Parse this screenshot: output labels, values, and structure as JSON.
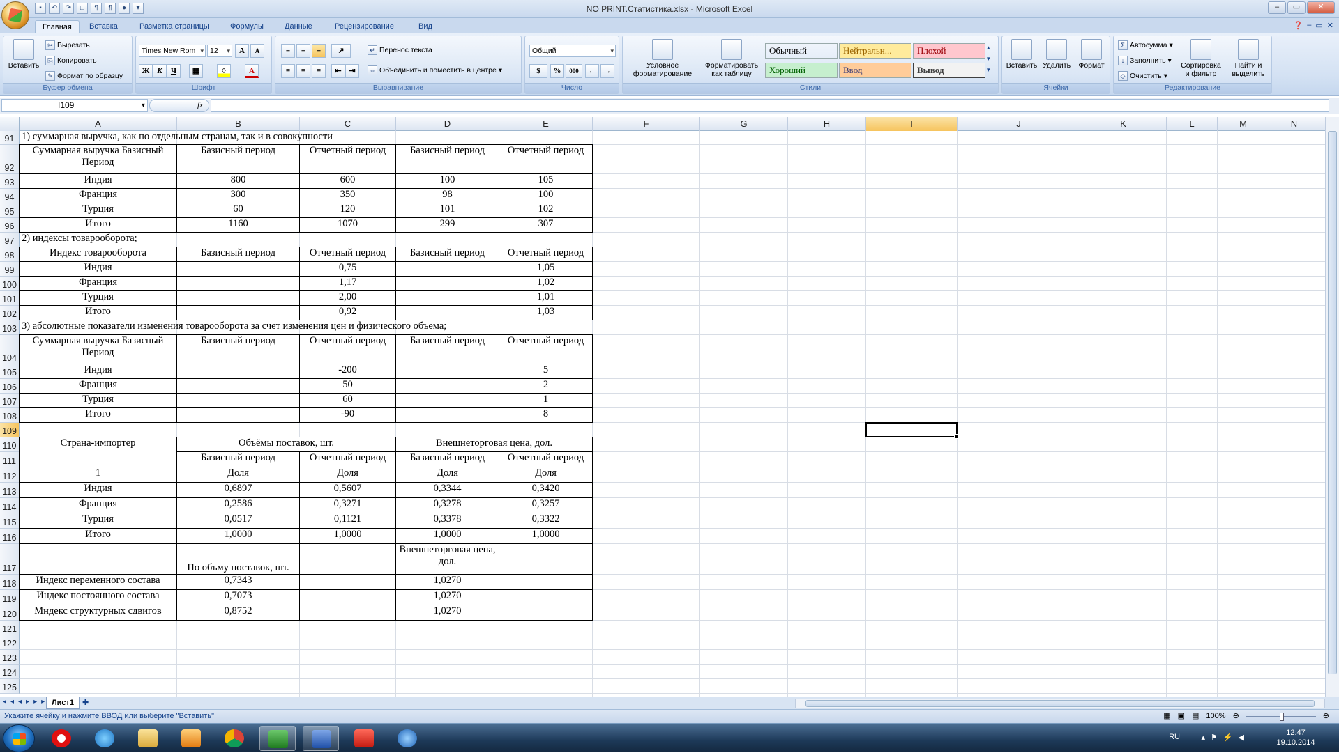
{
  "window": {
    "title": "NO PRINT.Статистика.xlsx - Microsoft Excel",
    "min": "–",
    "max": "▭",
    "close": "✕"
  },
  "tabs": [
    "Главная",
    "Вставка",
    "Разметка страницы",
    "Формулы",
    "Данные",
    "Рецензирование",
    "Вид"
  ],
  "ribbon": {
    "clipboard": {
      "label": "Буфер обмена",
      "paste": "Вставить",
      "cut": "Вырезать",
      "copy": "Копировать",
      "format_painter": "Формат по образцу"
    },
    "font": {
      "label": "Шрифт",
      "name": "Times New Rom",
      "size": "12",
      "bold": "Ж",
      "italic": "К",
      "underline": "Ч",
      "font_color": "A"
    },
    "alignment": {
      "label": "Выравнивание",
      "wrap": "Перенос текста",
      "merge": "Объединить и поместить в центре"
    },
    "number": {
      "label": "Число",
      "format": "Общий",
      "percent": "%",
      "thousands": "000"
    },
    "styles": {
      "label": "Стили",
      "cond_format": "Условное форматирование",
      "format_table": "Форматировать как таблицу",
      "boxes": [
        {
          "text": "Обычный",
          "bg": "#ffffff",
          "color": "#000000"
        },
        {
          "text": "Нейтральн...",
          "bg": "#ffeb9c",
          "color": "#9c6500"
        },
        {
          "text": "Плохой",
          "bg": "#ffc7ce",
          "color": "#9c0006"
        },
        {
          "text": "Хороший",
          "bg": "#c6efce",
          "color": "#006100"
        },
        {
          "text": "Ввод",
          "bg": "#ffcc99",
          "color": "#3f3f76"
        },
        {
          "text": "Вывод",
          "bg": "#f2f2f2",
          "color": "#3f3f3f"
        }
      ]
    },
    "cells": {
      "label": "Ячейки",
      "insert": "Вставить",
      "delete": "Удалить",
      "format": "Формат"
    },
    "editing": {
      "label": "Редактирование",
      "autosum": "Автосумма",
      "fill": "Заполнить",
      "clear": "Очистить",
      "sort": "Сортировка и фильтр",
      "find": "Найти и выделить"
    }
  },
  "formula_bar": {
    "name_box": "I109",
    "fx": "fx",
    "formula": ""
  },
  "columns": [
    "A",
    "B",
    "C",
    "D",
    "E",
    "F",
    "G",
    "H",
    "I",
    "J",
    "K",
    "L",
    "M",
    "N",
    "O"
  ],
  "selected_column": "I",
  "rows": [
    "91",
    "92",
    "93",
    "94",
    "95",
    "96",
    "97",
    "98",
    "99",
    "100",
    "101",
    "102",
    "103",
    "104",
    "105",
    "106",
    "107",
    "108",
    "109",
    "110",
    "111",
    "112",
    "113",
    "114",
    "115",
    "116",
    "117",
    "118",
    "119",
    "120",
    "121",
    "122",
    "123",
    "124",
    "125"
  ],
  "selected_row": "109",
  "sheet": {
    "r91": "1) суммарная выручка, как по отдельным странам, так и в совокупности",
    "hdr1": [
      "Суммарная выручка Базисный Период",
      "Базисный период",
      "Отчетный период",
      "Базисный период",
      "Отчетный период"
    ],
    "t1": [
      [
        "Индия",
        "800",
        "600",
        "100",
        "105"
      ],
      [
        "Франция",
        "300",
        "350",
        "98",
        "100"
      ],
      [
        "Турция",
        "60",
        "120",
        "101",
        "102"
      ],
      [
        "Итого",
        "1160",
        "1070",
        "299",
        "307"
      ]
    ],
    "r97": "2) индексы товарооборота;",
    "hdr2": [
      "Индекс товарооборота",
      "Базисный период",
      "Отчетный период",
      "Базисный период",
      "Отчетный период"
    ],
    "t2": [
      [
        "Индия",
        "",
        "0,75",
        "",
        "1,05"
      ],
      [
        "Франция",
        "",
        "1,17",
        "",
        "1,02"
      ],
      [
        "Турция",
        "",
        "2,00",
        "",
        "1,01"
      ],
      [
        "Итого",
        "",
        "0,92",
        "",
        "1,03"
      ]
    ],
    "r103": "3) абсолютные показатели изменения товарооборота за счет изменения цен и физического объема;",
    "hdr3": [
      "Суммарная выручка Базисный Период",
      "Базисный период",
      "Отчетный период",
      "Базисный период",
      "Отчетный период"
    ],
    "t3": [
      [
        "Индия",
        "",
        "-200",
        "",
        "5"
      ],
      [
        "Франция",
        "",
        "50",
        "",
        "2"
      ],
      [
        "Турция",
        "",
        "60",
        "",
        "1"
      ],
      [
        "Итого",
        "",
        "-90",
        "",
        "8"
      ]
    ],
    "hdr4": {
      "importer": "Страна-импортер",
      "volumes": "Объёмы поставок, шт.",
      "price": "Внешнеторговая цена, дол.",
      "base": "Базисный период",
      "report": "Отчетный период",
      "one": "1",
      "share": "Доля"
    },
    "t4": [
      [
        "Индия",
        "0,6897",
        "0,5607",
        "0,3344",
        "0,3420"
      ],
      [
        "Франция",
        "0,2586",
        "0,3271",
        "0,3278",
        "0,3257"
      ],
      [
        "Турция",
        "0,0517",
        "0,1121",
        "0,3378",
        "0,3322"
      ],
      [
        "Итого",
        "1,0000",
        "1,0000",
        "1,0000",
        "1,0000"
      ]
    ],
    "hdr5": {
      "by_volume": "По объму поставок, шт.",
      "by_price": "Внешнеторговая цена, дол."
    },
    "t5": [
      [
        "Индекс переменного состава",
        "0,7343",
        "",
        "1,0270",
        ""
      ],
      [
        "Индекс постоянного состава",
        "0,7073",
        "",
        "1,0270",
        ""
      ],
      [
        "Мндекс структурных сдвигов",
        "0,8752",
        "",
        "1,0270",
        ""
      ]
    ]
  },
  "sheet_tab": "Лист1",
  "status": {
    "text": "Укажите ячейку и нажмите ВВОД или выберите \"Вставить\"",
    "zoom": "100%"
  },
  "taskbar": {
    "lang": "RU",
    "time": "12:47",
    "date": "19.10.2014"
  }
}
